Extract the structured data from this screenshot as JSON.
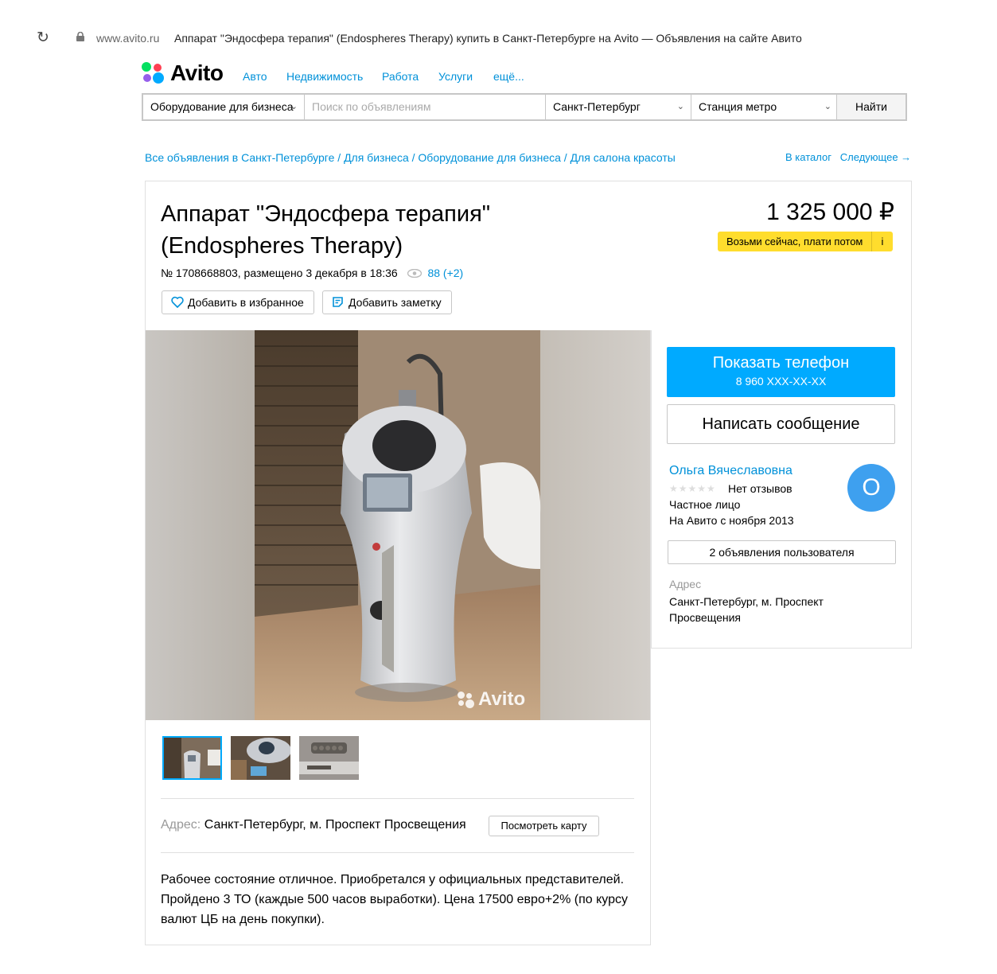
{
  "browser": {
    "domain": "www.avito.ru",
    "page_title": "Аппарат \"Эндосфера терапия\" (Endospheres Therapy) купить в Санкт-Петербурге на Avito — Объявления на сайте Авито"
  },
  "header": {
    "logo": "Avito",
    "nav": [
      "Авто",
      "Недвижимость",
      "Работа",
      "Услуги",
      "ещё..."
    ]
  },
  "search": {
    "category": "Оборудование для бизнеса",
    "placeholder": "Поиск по объявлениям",
    "city": "Санкт-Петербург",
    "metro": "Станция метро",
    "button": "Найти"
  },
  "breadcrumbs": [
    "Все объявления в Санкт-Петербурге",
    "Для бизнеса",
    "Оборудование для бизнеса",
    "Для салона красоты"
  ],
  "breadcrumb_right": {
    "catalog": "В каталог",
    "next": "Следующее →"
  },
  "listing": {
    "title": "Аппарат \"Эндосфера терапия\" (Endospheres Therapy)",
    "price": "1 325 000 ₽",
    "bnpl": "Возьми сейчас, плати потом",
    "bnpl_info": "i",
    "meta": "№ 1708668803, размещено 3 декабря в 18:36",
    "views": "88 (+2)",
    "favorite_button": "Добавить в избранное",
    "note_button": "Добавить заметку",
    "watermark": "Avito",
    "address_label": "Адрес:",
    "address": "Санкт-Петербург, м. Проспект Просвещения",
    "map_button": "Посмотреть карту",
    "description": "Рабочее состояние отличное. Приобретался у официальных представителей. Пройдено 3 ТО (каждые 500 часов выработки). Цена 17500 евро+2% (по курсу валют ЦБ на день покупки)."
  },
  "seller": {
    "phone_button": "Показать телефон",
    "phone": "8 960 XXX-XX-XX",
    "message_button": "Написать сообщение",
    "name": "Ольга Вячеславовна",
    "stars": "★★★★★",
    "reviews": "Нет отзывов",
    "type": "Частное лицо",
    "since": "На Авито с ноября 2013",
    "avatar_letter": "О",
    "ads_button": "2 объявления пользователя",
    "address_label": "Адрес",
    "address": "Санкт-Петербург, м. Проспект Просвещения"
  },
  "colors": {
    "link": "#0091d9",
    "primary_button": "#00aaff",
    "bnpl": "#ffdd2d",
    "avatar": "#3ea0ef"
  }
}
